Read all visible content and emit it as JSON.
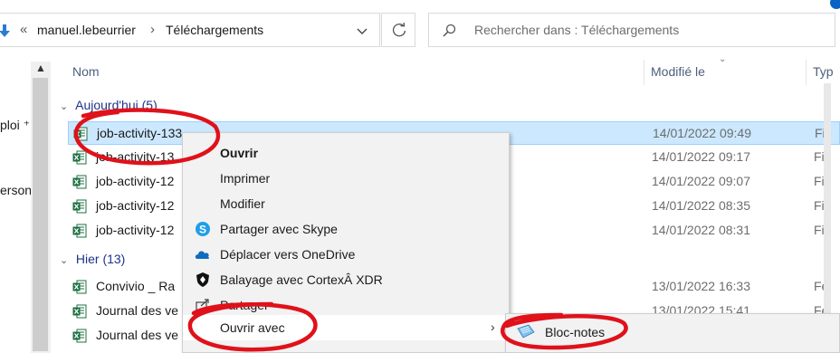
{
  "address_bar": {
    "overflow_symbol": "«",
    "crumbs": [
      "manuel.lebeurrier",
      "Téléchargements"
    ]
  },
  "search": {
    "placeholder": "Rechercher dans : Téléchargements"
  },
  "nav_pane": {
    "items": [
      "ploi ⁺",
      "erson"
    ]
  },
  "columns": {
    "name": "Nom",
    "modified": "Modifié le",
    "type": "Typ"
  },
  "groups": [
    {
      "label": "Aujourd'hui (5)",
      "files": [
        {
          "name": "job-activity-133",
          "date": "14/01/2022 09:49",
          "type": "Fic",
          "selected": true
        },
        {
          "name": "job-activity-13",
          "date": "14/01/2022 09:17",
          "type": "Fic"
        },
        {
          "name": "job-activity-12",
          "date": "14/01/2022 09:07",
          "type": "Fic"
        },
        {
          "name": "job-activity-12",
          "date": "14/01/2022 08:35",
          "type": "Fic"
        },
        {
          "name": "job-activity-12",
          "date": "14/01/2022 08:31",
          "type": "Fic"
        }
      ]
    },
    {
      "label": "Hier (13)",
      "files": [
        {
          "name": "Convivio _ Ra",
          "date": "13/01/2022 16:33",
          "type": "Fe"
        },
        {
          "name": "Journal des ve",
          "date": "13/01/2022 15:41",
          "type": "Fe"
        },
        {
          "name": "Journal des ve",
          "date": "",
          "type": "Fe"
        }
      ]
    }
  ],
  "context_menu": {
    "items": [
      {
        "label": "Ouvrir",
        "icon": "none",
        "bold": true
      },
      {
        "label": "Imprimer",
        "icon": "none"
      },
      {
        "label": "Modifier",
        "icon": "none"
      },
      {
        "label": "Partager avec Skype",
        "icon": "skype-icon"
      },
      {
        "label": "Déplacer vers OneDrive",
        "icon": "onedrive-icon"
      },
      {
        "label": "Balayage avec CortexÂ XDR",
        "icon": "cortex-shield-icon"
      },
      {
        "label": "Partager",
        "icon": "share-icon"
      },
      {
        "label": "Ouvrir avec",
        "icon": "none",
        "submenu": true,
        "highlighted": true
      }
    ],
    "submenu_arrow": "›"
  },
  "open_with_submenu": {
    "items": [
      {
        "label": "Bloc-notes",
        "icon": "notepad-icon"
      }
    ]
  },
  "colors": {
    "selection_bg": "#cce8ff",
    "group_text": "#1e3287",
    "annotation_red": "#e0111a",
    "excel_green": "#1d6f42"
  }
}
